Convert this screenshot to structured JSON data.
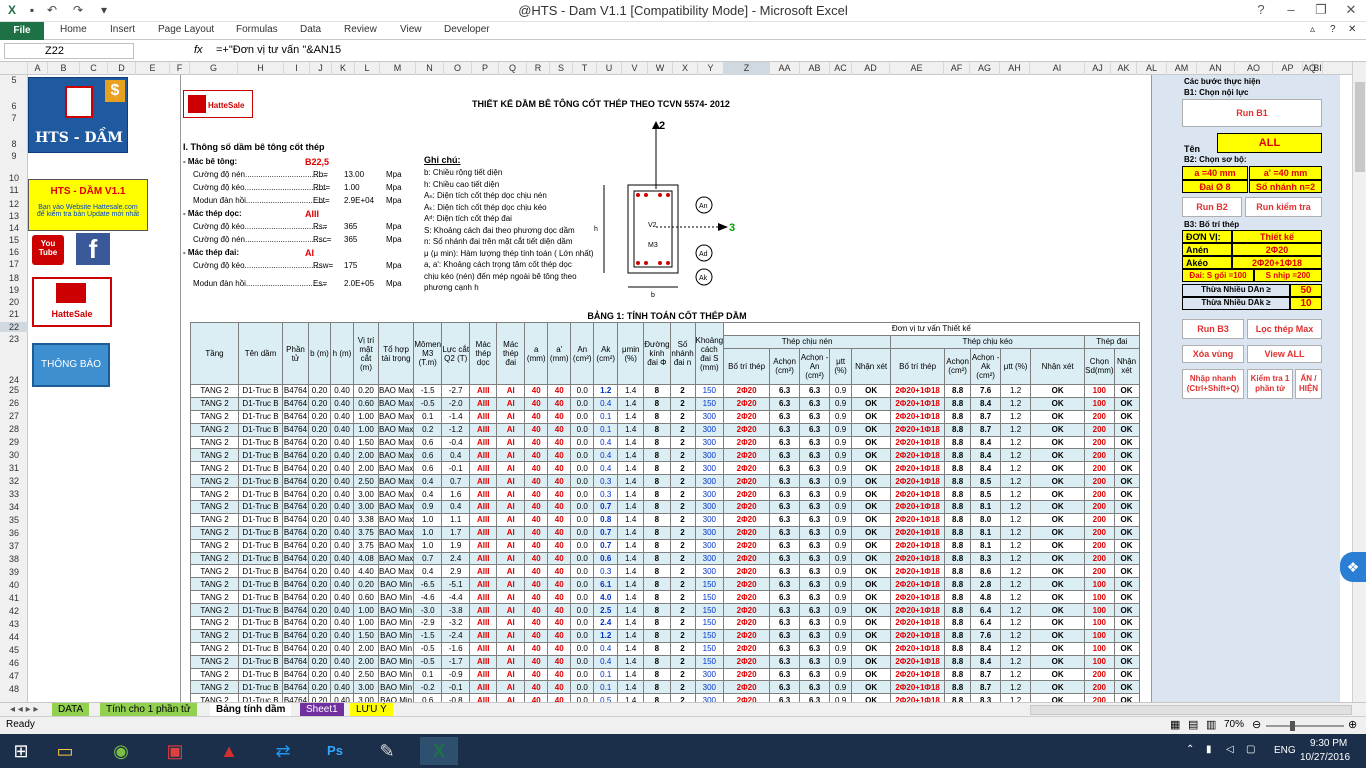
{
  "window": {
    "title": "@HTS - Dam V1.1  [Compatibility Mode] - Microsoft Excel"
  },
  "ribbon": {
    "file": "File",
    "tabs": [
      "Home",
      "Insert",
      "Page Layout",
      "Formulas",
      "Data",
      "Review",
      "View",
      "Developer"
    ]
  },
  "formula_bar": {
    "name_box": "Z22",
    "fx": "fx",
    "formula": "=+\"Đơn vị tư vấn \"&AN15"
  },
  "columns": [
    "A",
    "B",
    "C",
    "D",
    "E",
    "F",
    "G",
    "H",
    "I",
    "J",
    "K",
    "L",
    "M",
    "N",
    "O",
    "P",
    "Q",
    "R",
    "S",
    "T",
    "U",
    "V",
    "W",
    "X",
    "Y",
    "Z",
    "AA",
    "AB",
    "AC",
    "AD",
    "AE",
    "AF",
    "AG",
    "AH",
    "AI",
    "AJ",
    "AK",
    "AL",
    "AM",
    "AN",
    "AO",
    "AP",
    "AQ",
    "BI"
  ],
  "rows": [
    "5",
    "6",
    "7",
    "8",
    "9",
    "10",
    "11",
    "12",
    "13",
    "14",
    "15",
    "16",
    "17",
    "18",
    "19",
    "20",
    "21",
    "22",
    "23",
    "24",
    "25",
    "26",
    "27",
    "28",
    "29",
    "30",
    "31",
    "32",
    "33",
    "34",
    "35",
    "36",
    "37",
    "38",
    "39",
    "40",
    "41",
    "42",
    "43",
    "44",
    "45",
    "46",
    "47",
    "48",
    "49"
  ],
  "left_panel": {
    "logo_title": "HTS - DẦM",
    "version_box": "HTS - DẦM V1.1",
    "version_note1": "Bạn vào Website Hattesale.com",
    "version_note2": "để kiểm tra bản Update mới nhất",
    "youtube": "You Tube",
    "brand": "HatteSale",
    "notice_button": "THÔNG BÁO"
  },
  "sheet": {
    "brand": "HatteSale",
    "title": "THIẾT KẾ DẦM BÊ TÔNG CỐT THÉP THEO TCVN 5574- 2012",
    "section1": "I. Thông số dầm bê tông cốt thép",
    "params": [
      {
        "label": "- Mác bê tông:",
        "sym": "",
        "val": "B22,5",
        "unit": ""
      },
      {
        "label": "Cường độ nén.....................................",
        "sym": "Rb=",
        "val": "13.00",
        "unit": "Mpa"
      },
      {
        "label": "Cường độ kéo.....................................",
        "sym": "Rbt=",
        "val": "1.00",
        "unit": "Mpa"
      },
      {
        "label": "Modun đàn hồi....................................",
        "sym": "Ebt=",
        "val": "2.9E+04",
        "unit": "Mpa"
      },
      {
        "label": "- Mác thép dọc:",
        "sym": "",
        "val": "AIII",
        "unit": ""
      },
      {
        "label": "Cường độ kéo.....................................",
        "sym": "Rs=",
        "val": "365",
        "unit": "Mpa"
      },
      {
        "label": "Cường độ nén.....................................",
        "sym": "Rsc=",
        "val": "365",
        "unit": "Mpa"
      },
      {
        "label": "- Mác thép đai:",
        "sym": "",
        "val": "AI",
        "unit": ""
      },
      {
        "label": "Cường độ kéo...................................",
        "sym": "Rsw=",
        "val": "175",
        "unit": "Mpa"
      },
      {
        "label": "Modun đàn hồi....................................",
        "sym": "Es=",
        "val": "2.0E+05",
        "unit": "Mpa"
      }
    ],
    "notes_title": "Ghi chú:",
    "notes": [
      "b: Chiều rộng tiết diện",
      "h: Chiều cao tiết diện",
      "Aₙ: Diện tích cốt thép dọc chịu nén",
      "Aₖ: Diện tích cốt thép dọc chịu kéo",
      "Aᵈ: Diện tích cốt thép đai",
      "S: Khoảng cách đai theo phương dọc dầm",
      "n: Số nhánh đai trên mặt cắt tiết diện dầm",
      "μ (μ min): Hàm lượng thép tính toán ( Lớn nhất)",
      "a, a': Khoảng cách trọng tâm cốt thép dọc",
      "chịu kéo (nén)  đến mép ngoài bê tông theo",
      "phương cạnh h"
    ],
    "diagram": {
      "axis2": "2",
      "axis3": "3",
      "an": "An",
      "ad": "Ad",
      "ak": "Ak",
      "v2": "V2",
      "m3": "M3",
      "h": "h",
      "b": "b"
    },
    "table_title": "BẢNG 1: TÍNH TOÁN CỐT THÉP DẦM",
    "consult_header": "Đơn vị tư vấn Thiết kế",
    "group_nen": "Thép chịu nén",
    "group_keo": "Thép chịu kéo",
    "group_dai": "Thép đai",
    "headers": [
      "Tầng",
      "Tên dầm",
      "Phần tử",
      "b (m)",
      "h (m)",
      "Vị trí mặt cắt (m)",
      "Tổ hợp tải trọng",
      "Mômen M3 (T.m)",
      "Lực cắt Q2 (T)",
      "Mác thép dọc",
      "Mác thép đai",
      "a (mm)",
      "a' (mm)",
      "An (cm²)",
      "Ak (cm²)",
      "μmin (%)",
      "Đường kính đai Φ",
      "Số nhánh đai n",
      "Khoảng cách đai S (mm)",
      "Bố trí thép",
      "Achọn (cm²)",
      "Achọn - An (cm²)",
      "μtt (%)",
      "Nhận xét",
      "Bố trí thép",
      "Achọn (cm²)",
      "Achọn - Ak (cm²)",
      "μtt (%)",
      "Nhận xét",
      "Chọn Sd(mm)",
      "Nhận xét"
    ],
    "rows": [
      [
        "TANG 2",
        "D1-Truc B",
        "B4764",
        "0.20",
        "0.40",
        "0.20",
        "BAO Max",
        "-1.5",
        "-2.7",
        "AIII",
        "AI",
        "40",
        "40",
        "0.0",
        "1.2",
        "1.4",
        "8",
        "2",
        "150",
        "2Φ20",
        "6.3",
        "6.3",
        "0.9",
        "OK",
        "2Φ20+1Φ18",
        "8.8",
        "7.6",
        "1.2",
        "OK",
        "100",
        "OK"
      ],
      [
        "TANG 2",
        "D1-Truc B",
        "B4764",
        "0.20",
        "0.40",
        "0.60",
        "BAO Max",
        "-0.5",
        "-2.0",
        "AIII",
        "AI",
        "40",
        "40",
        "0.0",
        "0.4",
        "1.4",
        "8",
        "2",
        "150",
        "2Φ20",
        "6.3",
        "6.3",
        "0.9",
        "OK",
        "2Φ20+1Φ18",
        "8.8",
        "8.4",
        "1.2",
        "OK",
        "100",
        "OK"
      ],
      [
        "TANG 2",
        "D1-Truc B",
        "B4764",
        "0.20",
        "0.40",
        "1.00",
        "BAO Max",
        "0.1",
        "-1.4",
        "AIII",
        "AI",
        "40",
        "40",
        "0.0",
        "0.1",
        "1.4",
        "8",
        "2",
        "300",
        "2Φ20",
        "6.3",
        "6.3",
        "0.9",
        "OK",
        "2Φ20+1Φ18",
        "8.8",
        "8.7",
        "1.2",
        "OK",
        "200",
        "OK"
      ],
      [
        "TANG 2",
        "D1-Truc B",
        "B4764",
        "0.20",
        "0.40",
        "1.00",
        "BAO Max",
        "0.2",
        "-1.2",
        "AIII",
        "AI",
        "40",
        "40",
        "0.0",
        "0.1",
        "1.4",
        "8",
        "2",
        "300",
        "2Φ20",
        "6.3",
        "6.3",
        "0.9",
        "OK",
        "2Φ20+1Φ18",
        "8.8",
        "8.7",
        "1.2",
        "OK",
        "200",
        "OK"
      ],
      [
        "TANG 2",
        "D1-Truc B",
        "B4764",
        "0.20",
        "0.40",
        "1.50",
        "BAO Max",
        "0.6",
        "-0.4",
        "AIII",
        "AI",
        "40",
        "40",
        "0.0",
        "0.4",
        "1.4",
        "8",
        "2",
        "300",
        "2Φ20",
        "6.3",
        "6.3",
        "0.9",
        "OK",
        "2Φ20+1Φ18",
        "8.8",
        "8.4",
        "1.2",
        "OK",
        "200",
        "OK"
      ],
      [
        "TANG 2",
        "D1-Truc B",
        "B4764",
        "0.20",
        "0.40",
        "2.00",
        "BAO Max",
        "0.6",
        "0.4",
        "AIII",
        "AI",
        "40",
        "40",
        "0.0",
        "0.4",
        "1.4",
        "8",
        "2",
        "300",
        "2Φ20",
        "6.3",
        "6.3",
        "0.9",
        "OK",
        "2Φ20+1Φ18",
        "8.8",
        "8.4",
        "1.2",
        "OK",
        "200",
        "OK"
      ],
      [
        "TANG 2",
        "D1-Truc B",
        "B4764",
        "0.20",
        "0.40",
        "2.00",
        "BAO Max",
        "0.6",
        "-0.1",
        "AIII",
        "AI",
        "40",
        "40",
        "0.0",
        "0.4",
        "1.4",
        "8",
        "2",
        "300",
        "2Φ20",
        "6.3",
        "6.3",
        "0.9",
        "OK",
        "2Φ20+1Φ18",
        "8.8",
        "8.4",
        "1.2",
        "OK",
        "200",
        "OK"
      ],
      [
        "TANG 2",
        "D1-Truc B",
        "B4764",
        "0.20",
        "0.40",
        "2.50",
        "BAO Max",
        "0.4",
        "0.7",
        "AIII",
        "AI",
        "40",
        "40",
        "0.0",
        "0.3",
        "1.4",
        "8",
        "2",
        "300",
        "2Φ20",
        "6.3",
        "6.3",
        "0.9",
        "OK",
        "2Φ20+1Φ18",
        "8.8",
        "8.5",
        "1.2",
        "OK",
        "200",
        "OK"
      ],
      [
        "TANG 2",
        "D1-Truc B",
        "B4764",
        "0.20",
        "0.40",
        "3.00",
        "BAO Max",
        "0.4",
        "1.6",
        "AIII",
        "AI",
        "40",
        "40",
        "0.0",
        "0.3",
        "1.4",
        "8",
        "2",
        "300",
        "2Φ20",
        "6.3",
        "6.3",
        "0.9",
        "OK",
        "2Φ20+1Φ18",
        "8.8",
        "8.5",
        "1.2",
        "OK",
        "200",
        "OK"
      ],
      [
        "TANG 2",
        "D1-Truc B",
        "B4764",
        "0.20",
        "0.40",
        "3.00",
        "BAO Max",
        "0.9",
        "0.4",
        "AIII",
        "AI",
        "40",
        "40",
        "0.0",
        "0.7",
        "1.4",
        "8",
        "2",
        "300",
        "2Φ20",
        "6.3",
        "6.3",
        "0.9",
        "OK",
        "2Φ20+1Φ18",
        "8.8",
        "8.1",
        "1.2",
        "OK",
        "200",
        "OK"
      ],
      [
        "TANG 2",
        "D1-Truc B",
        "B4764",
        "0.20",
        "0.40",
        "3.38",
        "BAO Max",
        "1.0",
        "1.1",
        "AIII",
        "AI",
        "40",
        "40",
        "0.0",
        "0.8",
        "1.4",
        "8",
        "2",
        "300",
        "2Φ20",
        "6.3",
        "6.3",
        "0.9",
        "OK",
        "2Φ20+1Φ18",
        "8.8",
        "8.0",
        "1.2",
        "OK",
        "200",
        "OK"
      ],
      [
        "TANG 2",
        "D1-Truc B",
        "B4764",
        "0.20",
        "0.40",
        "3.75",
        "BAO Max",
        "1.0",
        "1.7",
        "AIII",
        "AI",
        "40",
        "40",
        "0.0",
        "0.7",
        "1.4",
        "8",
        "2",
        "300",
        "2Φ20",
        "6.3",
        "6.3",
        "0.9",
        "OK",
        "2Φ20+1Φ18",
        "8.8",
        "8.1",
        "1.2",
        "OK",
        "200",
        "OK"
      ],
      [
        "TANG 2",
        "D1-Truc B",
        "B4764",
        "0.20",
        "0.40",
        "3.75",
        "BAO Max",
        "1.0",
        "1.9",
        "AIII",
        "AI",
        "40",
        "40",
        "0.0",
        "0.7",
        "1.4",
        "8",
        "2",
        "300",
        "2Φ20",
        "6.3",
        "6.3",
        "0.9",
        "OK",
        "2Φ20+1Φ18",
        "8.8",
        "8.1",
        "1.2",
        "OK",
        "200",
        "OK"
      ],
      [
        "TANG 2",
        "D1-Truc B",
        "B4764",
        "0.20",
        "0.40",
        "4.08",
        "BAO Max",
        "0.7",
        "2.4",
        "AIII",
        "AI",
        "40",
        "40",
        "0.0",
        "0.6",
        "1.4",
        "8",
        "2",
        "300",
        "2Φ20",
        "6.3",
        "6.3",
        "0.9",
        "OK",
        "2Φ20+1Φ18",
        "8.8",
        "8.3",
        "1.2",
        "OK",
        "200",
        "OK"
      ],
      [
        "TANG 2",
        "D1-Truc B",
        "B4764",
        "0.20",
        "0.40",
        "4.40",
        "BAO Max",
        "0.4",
        "2.9",
        "AIII",
        "AI",
        "40",
        "40",
        "0.0",
        "0.3",
        "1.4",
        "8",
        "2",
        "300",
        "2Φ20",
        "6.3",
        "6.3",
        "0.9",
        "OK",
        "2Φ20+1Φ18",
        "8.8",
        "8.6",
        "1.2",
        "OK",
        "200",
        "OK"
      ],
      [
        "TANG 2",
        "D1-Truc B",
        "B4764",
        "0.20",
        "0.40",
        "0.20",
        "BAO Min",
        "-6.5",
        "-5.1",
        "AIII",
        "AI",
        "40",
        "40",
        "0.0",
        "6.1",
        "1.4",
        "8",
        "2",
        "150",
        "2Φ20",
        "6.3",
        "6.3",
        "0.9",
        "OK",
        "2Φ20+1Φ18",
        "8.8",
        "2.8",
        "1.2",
        "OK",
        "100",
        "OK"
      ],
      [
        "TANG 2",
        "D1-Truc B",
        "B4764",
        "0.20",
        "0.40",
        "0.60",
        "BAO Min",
        "-4.6",
        "-4.4",
        "AIII",
        "AI",
        "40",
        "40",
        "0.0",
        "4.0",
        "1.4",
        "8",
        "2",
        "150",
        "2Φ20",
        "6.3",
        "6.3",
        "0.9",
        "OK",
        "2Φ20+1Φ18",
        "8.8",
        "4.8",
        "1.2",
        "OK",
        "100",
        "OK"
      ],
      [
        "TANG 2",
        "D1-Truc B",
        "B4764",
        "0.20",
        "0.40",
        "1.00",
        "BAO Min",
        "-3.0",
        "-3.8",
        "AIII",
        "AI",
        "40",
        "40",
        "0.0",
        "2.5",
        "1.4",
        "8",
        "2",
        "150",
        "2Φ20",
        "6.3",
        "6.3",
        "0.9",
        "OK",
        "2Φ20+1Φ18",
        "8.8",
        "6.4",
        "1.2",
        "OK",
        "100",
        "OK"
      ],
      [
        "TANG 2",
        "D1-Truc B",
        "B4764",
        "0.20",
        "0.40",
        "1.00",
        "BAO Min",
        "-2.9",
        "-3.2",
        "AIII",
        "AI",
        "40",
        "40",
        "0.0",
        "2.4",
        "1.4",
        "8",
        "2",
        "150",
        "2Φ20",
        "6.3",
        "6.3",
        "0.9",
        "OK",
        "2Φ20+1Φ18",
        "8.8",
        "6.4",
        "1.2",
        "OK",
        "100",
        "OK"
      ],
      [
        "TANG 2",
        "D1-Truc B",
        "B4764",
        "0.20",
        "0.40",
        "1.50",
        "BAO Min",
        "-1.5",
        "-2.4",
        "AIII",
        "AI",
        "40",
        "40",
        "0.0",
        "1.2",
        "1.4",
        "8",
        "2",
        "150",
        "2Φ20",
        "6.3",
        "6.3",
        "0.9",
        "OK",
        "2Φ20+1Φ18",
        "8.8",
        "7.6",
        "1.2",
        "OK",
        "100",
        "OK"
      ],
      [
        "TANG 2",
        "D1-Truc B",
        "B4764",
        "0.20",
        "0.40",
        "2.00",
        "BAO Min",
        "-0.5",
        "-1.6",
        "AIII",
        "AI",
        "40",
        "40",
        "0.0",
        "0.4",
        "1.4",
        "8",
        "2",
        "150",
        "2Φ20",
        "6.3",
        "6.3",
        "0.9",
        "OK",
        "2Φ20+1Φ18",
        "8.8",
        "8.4",
        "1.2",
        "OK",
        "100",
        "OK"
      ],
      [
        "TANG 2",
        "D1-Truc B",
        "B4764",
        "0.20",
        "0.40",
        "2.00",
        "BAO Min",
        "-0.5",
        "-1.7",
        "AIII",
        "AI",
        "40",
        "40",
        "0.0",
        "0.4",
        "1.4",
        "8",
        "2",
        "150",
        "2Φ20",
        "6.3",
        "6.3",
        "0.9",
        "OK",
        "2Φ20+1Φ18",
        "8.8",
        "8.4",
        "1.2",
        "OK",
        "100",
        "OK"
      ],
      [
        "TANG 2",
        "D1-Truc B",
        "B4764",
        "0.20",
        "0.40",
        "2.50",
        "BAO Min",
        "0.1",
        "-0.9",
        "AIII",
        "AI",
        "40",
        "40",
        "0.0",
        "0.1",
        "1.4",
        "8",
        "2",
        "300",
        "2Φ20",
        "6.3",
        "6.3",
        "0.9",
        "OK",
        "2Φ20+1Φ18",
        "8.8",
        "8.7",
        "1.2",
        "OK",
        "200",
        "OK"
      ],
      [
        "TANG 2",
        "D1-Truc B",
        "B4764",
        "0.20",
        "0.40",
        "3.00",
        "BAO Min",
        "-0.2",
        "-0.1",
        "AIII",
        "AI",
        "40",
        "40",
        "0.0",
        "0.1",
        "1.4",
        "8",
        "2",
        "300",
        "2Φ20",
        "6.3",
        "6.3",
        "0.9",
        "OK",
        "2Φ20+1Φ18",
        "8.8",
        "8.7",
        "1.2",
        "OK",
        "200",
        "OK"
      ],
      [
        "TANG 2",
        "D1-Truc B",
        "B4764",
        "0.20",
        "0.40",
        "3.00",
        "BAO Min",
        "0.6",
        "-0.8",
        "AIII",
        "AI",
        "40",
        "40",
        "0.0",
        "0.5",
        "1.4",
        "8",
        "2",
        "300",
        "2Φ20",
        "6.3",
        "6.3",
        "0.9",
        "OK",
        "2Φ20+1Φ18",
        "8.8",
        "8.3",
        "1.2",
        "OK",
        "200",
        "OK"
      ]
    ]
  },
  "right_panel": {
    "steps_title": "Các bước thực hiện",
    "step1": "B1: Chọn nội lực",
    "run_b1": "Run B1",
    "ten_label": "Tên",
    "ten_value": "ALL",
    "step2": "B2: Chọn sơ bộ:",
    "a_val": "a =40 mm",
    "a2_val": "a' =40 mm",
    "dai_val": "Đai Ø 8",
    "nhanh_val": "Số nhánh n=2",
    "run_b2": "Run B2",
    "run_check": "Run kiểm tra",
    "step3": "B3: Bố trí thép",
    "don_vi_label": "ĐƠN VỊ:",
    "don_vi_value": "Thiết kế",
    "anen_label": "Anén",
    "anen_value": "2Φ20",
    "akeo_label": "Akéo",
    "akeo_value": "2Φ20+1Φ18",
    "dai_s_goi": "Đai: S gối =100",
    "s_nhip": "S nhịp =200",
    "thua_dan": "Thừa Nhiều  DAn ≥",
    "thua_dan_val": "50",
    "thua_dak": "Thừa Nhiều  DAk ≥",
    "thua_dak_val": "10",
    "run_b3": "Run B3",
    "loc_max": "Lọc thép Max",
    "xoa_vung": "Xóa vùng",
    "view_all": "View ALL",
    "nhap_nhanh": "Nhập nhanh (Ctrl+Shift+Q)",
    "kiem_tra": "Kiểm tra 1 phần tử",
    "an_hien": "ẨN / HIỆN"
  },
  "sheet_tabs": [
    "DATA",
    "Tính cho 1 phần tử",
    "Bảng tính dầm",
    "Sheet1",
    "LƯU Ý"
  ],
  "status": {
    "ready": "Ready",
    "zoom": "70%"
  },
  "taskbar": {
    "lang": "ENG",
    "time": "9:30 PM",
    "date": "10/27/2016"
  }
}
